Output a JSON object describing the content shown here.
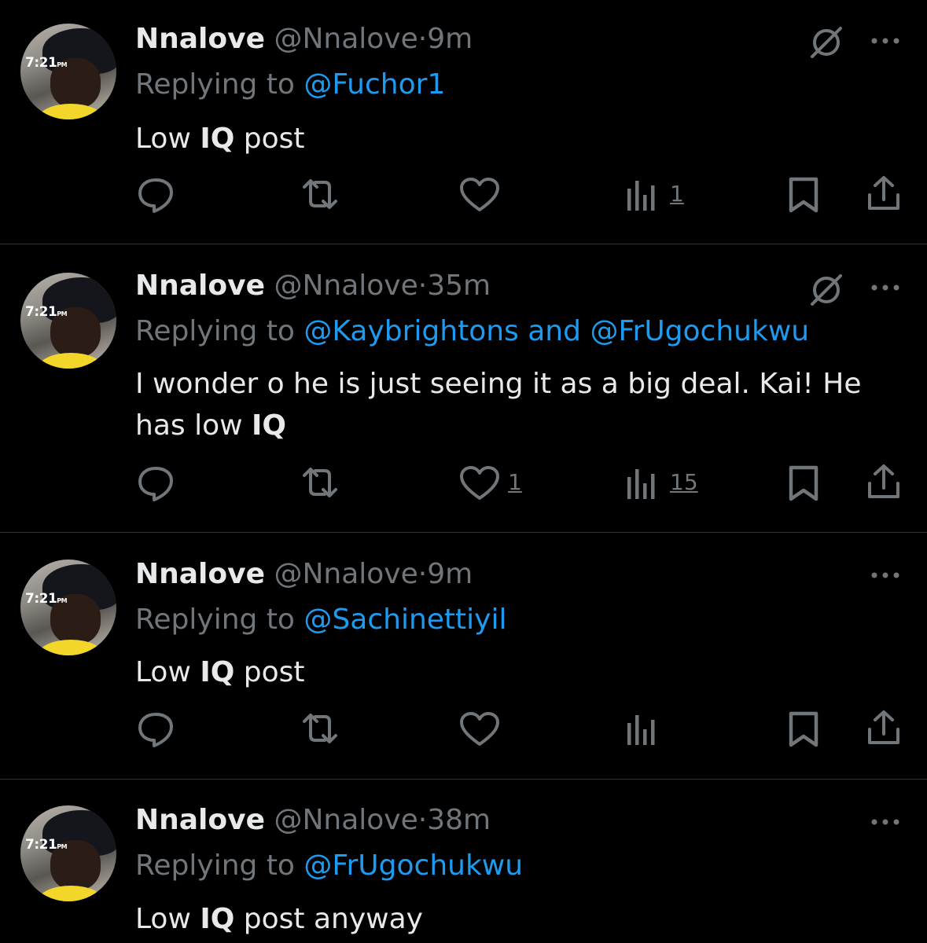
{
  "colors": {
    "background": "#000000",
    "text": "#e7e9ea",
    "muted": "#71767b",
    "link": "#1d9bf0",
    "divider": "#2f3336"
  },
  "avatar_overlay_text": "7:21",
  "avatar_overlay_suffix": "PM",
  "icons": {
    "reply": "speech-bubble-icon",
    "repost": "repost-arrows-icon",
    "like": "heart-icon",
    "views": "bar-chart-icon",
    "bookmark": "bookmark-icon",
    "share": "share-upload-icon",
    "grok": "slashed-circle-icon",
    "more": "three-dots-icon"
  },
  "tweets": [
    {
      "name": "Nnalove",
      "handle": "@Nnalove",
      "separator": "·",
      "age": "9m",
      "replying_prefix": "Replying to",
      "mention_1": "@Fuchor1",
      "body_before": "Low ",
      "body_bold": "IQ",
      "body_after": " post",
      "likes": "",
      "views": "1"
    },
    {
      "name": "Nnalove",
      "handle": "@Nnalove",
      "separator": "·",
      "age": "35m",
      "replying_prefix": "Replying to",
      "mention_1": "@Kaybrightons",
      "mention_and": "and",
      "mention_2": "@FrUgochukwu",
      "body_before": "I wonder o he is just seeing it as a big deal. Kai! He has low ",
      "body_bold": "IQ",
      "body_after": "",
      "likes": "1",
      "views": "15"
    },
    {
      "name": "Nnalove",
      "handle": "@Nnalove",
      "separator": "·",
      "age": "9m",
      "replying_prefix": "Replying to",
      "mention_1": "@Sachinettiyil",
      "body_before": "Low ",
      "body_bold": "IQ",
      "body_after": " post",
      "likes": "",
      "views": ""
    },
    {
      "name": "Nnalove",
      "handle": "@Nnalove",
      "separator": "·",
      "age": "38m",
      "replying_prefix": "Replying to",
      "mention_1": "@FrUgochukwu",
      "body_before": "Low ",
      "body_bold": "IQ",
      "body_after": " post anyway",
      "likes": "",
      "views": ""
    }
  ]
}
